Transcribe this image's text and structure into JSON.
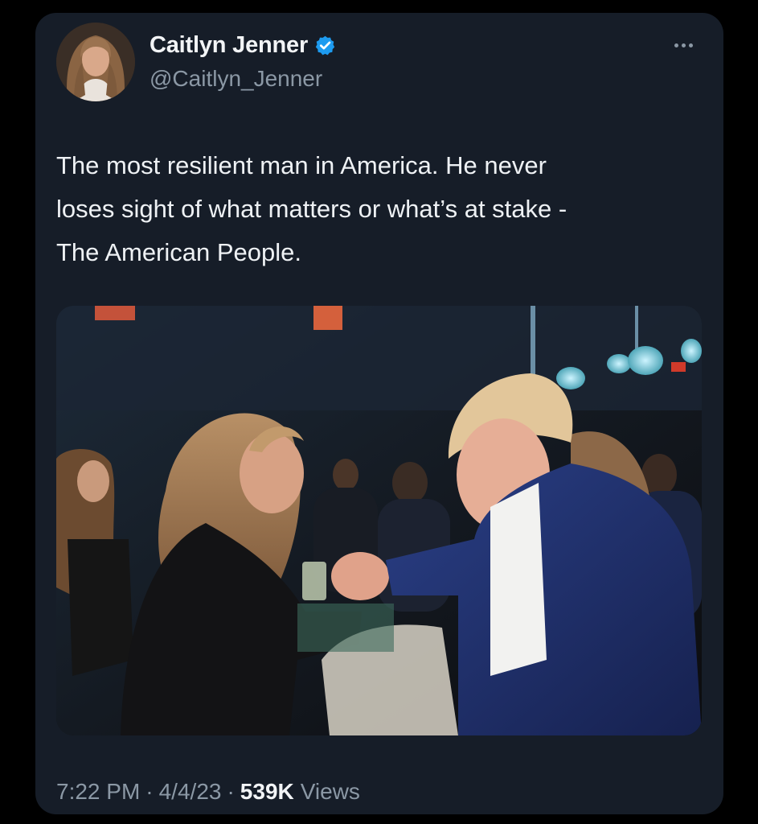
{
  "tweet": {
    "author": {
      "display_name": "Caitlyn Jenner",
      "handle": "@Caitlyn_Jenner",
      "verified": true,
      "verified_icon": "verified-badge-icon",
      "verified_color": "#1d9bf0"
    },
    "more_icon": "more-options-icon",
    "text": "The most resilient man in America. He never\nloses sight of what matters or what’s at stake -\nThe American People.",
    "media": {
      "type": "photo"
    },
    "meta": {
      "time": "7:22 PM",
      "date": "4/4/23",
      "separator": "·",
      "views_count": "539K",
      "views_label": "Views"
    }
  },
  "colors": {
    "page_background": "#000000",
    "card_background": "#161d28",
    "primary_text": "#eef1f4",
    "secondary_text": "#8b98a5"
  }
}
